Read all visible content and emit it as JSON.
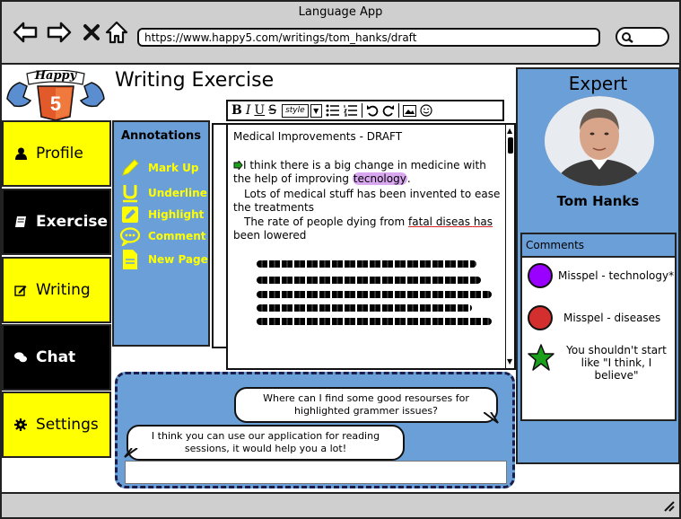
{
  "window": {
    "title": "Language App",
    "url": "https://www.happy5.com/writings/tom_hanks/draft"
  },
  "logo": {
    "text": "Happy"
  },
  "page": {
    "title": "Writing Exercise"
  },
  "nav": {
    "items": [
      {
        "label": "Profile",
        "icon": "user-icon"
      },
      {
        "label": "Exercise",
        "icon": "book-icon"
      },
      {
        "label": "Writing",
        "icon": "edit-icon"
      },
      {
        "label": "Chat",
        "icon": "chat-icon"
      },
      {
        "label": "Settings",
        "icon": "gear-icon"
      }
    ]
  },
  "annotations": {
    "title": "Annotations",
    "items": [
      {
        "label": "Mark Up",
        "icon": "pencil-icon"
      },
      {
        "label": "Underline",
        "icon": "underline-icon"
      },
      {
        "label": "Highlight",
        "icon": "highlighter-icon"
      },
      {
        "label": "Comment",
        "icon": "comment-icon"
      },
      {
        "label": "New Page",
        "icon": "new-page-icon"
      }
    ]
  },
  "toolbar": {
    "style_label": "style"
  },
  "document": {
    "heading": "Medical Improvements - DRAFT",
    "p1_a": "I think there is a big change in medicine with the help of improving ",
    "p1_word": "tecnology",
    "p1_b": ".",
    "p2": "Lots of medical stuff has been invented to ease the treatments",
    "p3_a": "The rate of people dying from ",
    "p3_err": "fatal diseas has",
    "p3_b": " been lowered"
  },
  "expert": {
    "title": "Expert",
    "name": "Tom Hanks"
  },
  "comments": {
    "title": "Comments",
    "items": [
      {
        "text": "Misspel - technology*",
        "marker": "purple-circle",
        "color": "#9900ff"
      },
      {
        "text": "Misspel - diseases",
        "marker": "red-circle",
        "color": "#d32f2f"
      },
      {
        "text": "You shouldn't start like \"I think, I believe\"",
        "marker": "green-star",
        "color": "#1aa01a"
      }
    ]
  },
  "chat": {
    "messages": [
      {
        "text": "Where can I find some good resourses for highlighted grammer issues?"
      },
      {
        "text": "I think you can use our application for reading sessions, it would help you a lot!"
      }
    ]
  }
}
